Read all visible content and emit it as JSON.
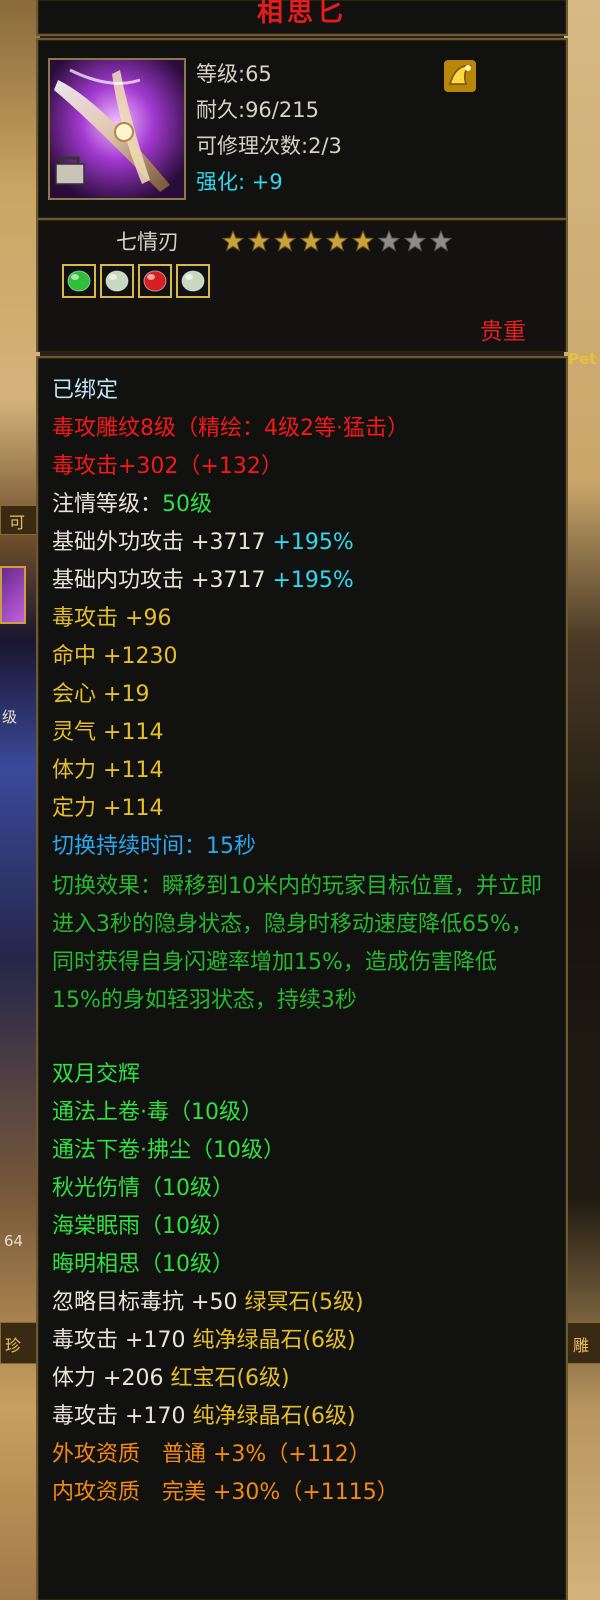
{
  "window_title": "相思匕",
  "icon": {
    "name": "dagger-weapon-icon",
    "lock": "lock-icon",
    "badge": "gold-enhance-badge-icon"
  },
  "info": {
    "level": "等级:65",
    "durability": "耐久:96/215",
    "repairs": "可修理次数:2/3",
    "enhance_label": "强化:",
    "enhance_value": "+9"
  },
  "weapon_type": "七情刃",
  "stars": {
    "filled": 6,
    "total": 9
  },
  "gems": [
    {
      "name": "green-gem-icon",
      "color": "#2fbf3a"
    },
    {
      "name": "white-jade-gem-icon",
      "color": "#c9d8c0"
    },
    {
      "name": "red-gem-icon",
      "color": "#d42020"
    },
    {
      "name": "white-jade-gem-icon-2",
      "color": "#c9d8c0"
    }
  ],
  "rarity": "贵重",
  "details": {
    "bound": "已绑定",
    "engrave": "毒攻雕纹8级（精绘：4级2等·猛击）",
    "poison_atk": "毒攻击+302（+132）",
    "infuse_label": "注情等级：",
    "infuse_value": "50级",
    "base_ext_label": "基础外功攻击",
    "base_ext_value": "+3717",
    "base_ext_pct": "+195%",
    "base_int_label": "基础内功攻击",
    "base_int_value": "+3717",
    "base_int_pct": "+195%",
    "stats": [
      {
        "label": "毒攻击",
        "value": "+96"
      },
      {
        "label": "命中",
        "value": "+1230"
      },
      {
        "label": "会心",
        "value": "+19"
      },
      {
        "label": "灵气",
        "value": "+114"
      },
      {
        "label": "体力",
        "value": "+114"
      },
      {
        "label": "定力",
        "value": "+114"
      }
    ],
    "switch_duration": "切换持续时间：15秒",
    "switch_effect": "切换效果：瞬移到10米内的玩家目标位置，并立即进入3秒的隐身状态，隐身时移动速度降低65%，同时获得自身闪避率增加15%，造成伤害降低15%的身如轻羽状态，持续3秒",
    "set_name": "双月交辉",
    "skills": [
      "通法上卷·毒（10级）",
      "通法下卷·拂尘（10级）",
      "秋光伤情（10级）",
      "海棠眠雨（10级）",
      "晦明相思（10级）"
    ],
    "gem_lines": [
      {
        "stat": "忽略目标毒抗",
        "value": "+50",
        "gem": "绿冥石(5级)"
      },
      {
        "stat": "毒攻击",
        "value": "+170",
        "gem": "纯净绿晶石(6级)"
      },
      {
        "stat": "体力",
        "value": "+206",
        "gem": "红宝石(6级)"
      },
      {
        "stat": "毒攻击",
        "value": "+170",
        "gem": "纯净绿晶石(6级)"
      }
    ],
    "quality_ext": "外攻资质　普通 +3%（+112）",
    "quality_int": "内攻资质　完美 +30%（+1115）"
  },
  "scene": {
    "left_labels": [
      "可",
      "级",
      "64",
      "珍"
    ],
    "right_labels": [
      "Pet",
      "雕"
    ]
  }
}
